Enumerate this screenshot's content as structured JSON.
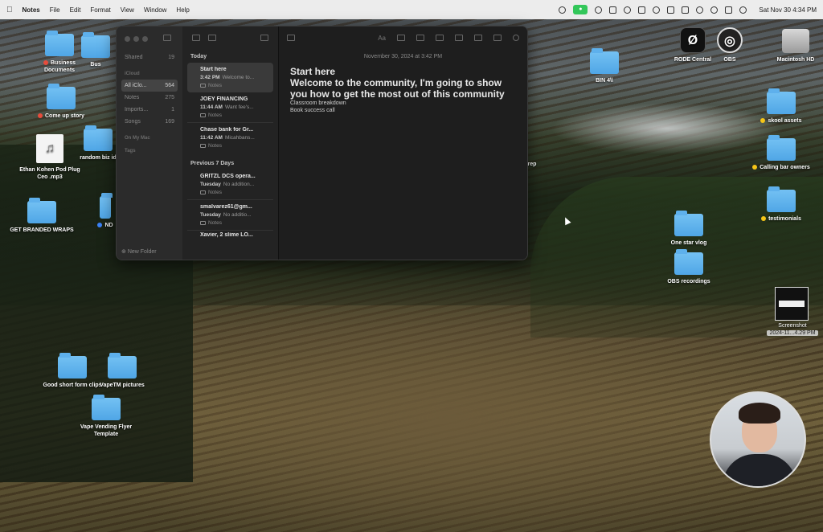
{
  "menubar": {
    "app_name": "Notes",
    "menus": [
      "File",
      "Edit",
      "Format",
      "View",
      "Window",
      "Help"
    ],
    "clock": "Sat Nov 30  4:34 PM"
  },
  "desktop": {
    "business_documents": "Business Documents",
    "partial_top": "Bus",
    "come_up_story": "Come up story",
    "ethan_file": "Ethan Kohen Pod Plug Ceo .mp3",
    "random_biz": "random biz id",
    "get_branded_wraps": "GET BRANDED WRAPS",
    "partial_nd": "ND",
    "good_short_form": "Good short form clips",
    "vapetm_pictures": "VapeTM pictures",
    "vape_vending": "Vape Vending Flyer Template",
    "bin_folder": "BIN 4\\\\",
    "partial_rep": "rep",
    "rode_central": "RODE Central",
    "obs": "OBS",
    "macintosh_hd": "Macintosh HD",
    "skool_assets": "skool assets",
    "calling_bar_owners": "Calling bar owners",
    "testimonials": "testimonials",
    "one_star_vlog": "One star vlog",
    "obs_recordings": "OBS recordings",
    "screenshot_name": "Screenshot",
    "screenshot_date": "2024-11...4.29 PM"
  },
  "sidebar": {
    "shared_label": "Shared",
    "shared_count": "19",
    "icloud_section": "iCloud",
    "items": [
      {
        "label": "All iClo...",
        "count": "564"
      },
      {
        "label": "Notes",
        "count": "275"
      },
      {
        "label": "Imports...",
        "count": "1"
      },
      {
        "label": "Songs",
        "count": "169"
      }
    ],
    "onmymac_section": "On My Mac",
    "tags_section": "Tags",
    "new_folder": "New Folder"
  },
  "notelist": {
    "today_label": "Today",
    "prev7_label": "Previous 7 Days",
    "today_notes": [
      {
        "title": "Start here",
        "time": "3:42 PM",
        "preview": "Welcome to...",
        "folder": "Notes"
      },
      {
        "title": "JOEY FINANCING",
        "time": "11:44 AM",
        "preview": "Want fee's...",
        "folder": "Notes"
      },
      {
        "title": "Chase bank for Gr...",
        "time": "11:42 AM",
        "preview": "Micahbans...",
        "folder": "Notes"
      }
    ],
    "prev_notes": [
      {
        "title": "GRITZL DCS opera...",
        "time": "Tuesday",
        "preview": "No addition...",
        "folder": "Notes"
      },
      {
        "title": "smalvarez61@gm...",
        "time": "Tuesday",
        "preview": "No additio...",
        "folder": "Notes"
      },
      {
        "title": "Xavier, 2 slime LO...",
        "time": "",
        "preview": "",
        "folder": ""
      }
    ]
  },
  "editor": {
    "font_label": "Aa",
    "date": "November 30, 2024 at 3:42 PM",
    "title": "Start here",
    "headline": "Welcome to the community, I'm going to show you how to get the most out of this community",
    "lines": [
      "Classroom breakdown",
      "Book success call"
    ]
  }
}
